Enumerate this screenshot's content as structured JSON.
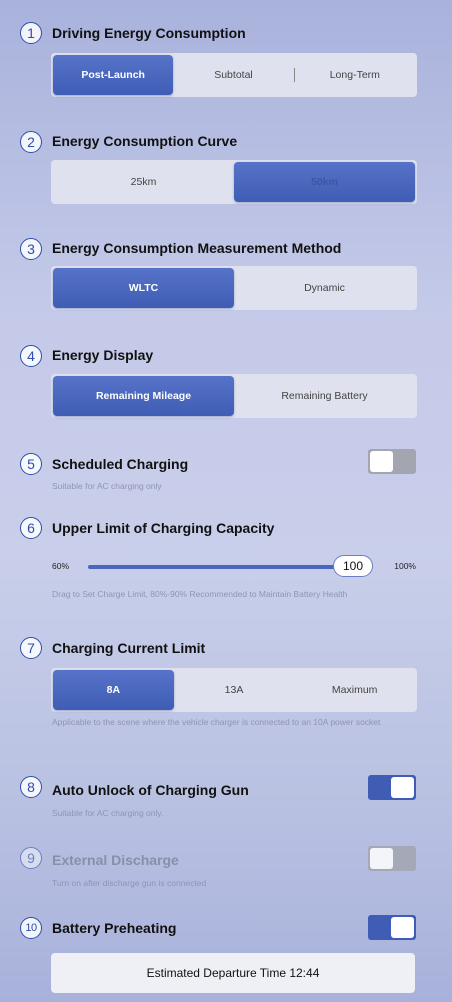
{
  "sections": {
    "s1": {
      "num": "1",
      "title": "Driving Energy Consumption",
      "options": [
        "Post-Launch",
        "Subtotal",
        "Long-Term"
      ],
      "selected": "Post-Launch"
    },
    "s2": {
      "num": "2",
      "title": "Energy Consumption Curve",
      "options": [
        "25km",
        "50km"
      ],
      "selected": "50km"
    },
    "s3": {
      "num": "3",
      "title": "Energy Consumption Measurement Method",
      "options": [
        "WLTC",
        "Dynamic"
      ],
      "selected": "WLTC"
    },
    "s4": {
      "num": "4",
      "title": "Energy Display",
      "options": [
        "Remaining Mileage",
        "Remaining Battery"
      ],
      "selected": "Remaining Mileage"
    },
    "s5": {
      "num": "5",
      "title": "Scheduled Charging",
      "hint": "Suitable for AC charging only",
      "toggle": "off"
    },
    "s6": {
      "num": "6",
      "title": "Upper Limit of Charging Capacity",
      "min_label": "60%",
      "max_label": "100%",
      "value": "100",
      "hint": "Drag to Set  Charge Limit, 80%-90% Recommended to Maintain Battery Health"
    },
    "s7": {
      "num": "7",
      "title": "Charging Current Limit",
      "options": [
        "8A",
        "13A",
        "Maximum"
      ],
      "selected": "8A",
      "hint": "Applicable to the scene where the vehicle charger is connected to an 10A power socket"
    },
    "s8": {
      "num": "8",
      "title": "Auto Unlock of Charging Gun",
      "hint": "Suitable for AC charging only.",
      "toggle": "on"
    },
    "s9": {
      "num": "9",
      "title": "External Discharge",
      "hint": "Turn on after discharge gun is connected",
      "toggle": "off",
      "disabled": true
    },
    "s10": {
      "num": "10",
      "title": "Battery Preheating",
      "toggle": "on",
      "departure_label": "Estimated Departure Time 12:44"
    }
  },
  "colors": {
    "accent": "#3f5db5",
    "toggle_off": "#a3a5b1",
    "number_ring": "#2d4fa8"
  }
}
